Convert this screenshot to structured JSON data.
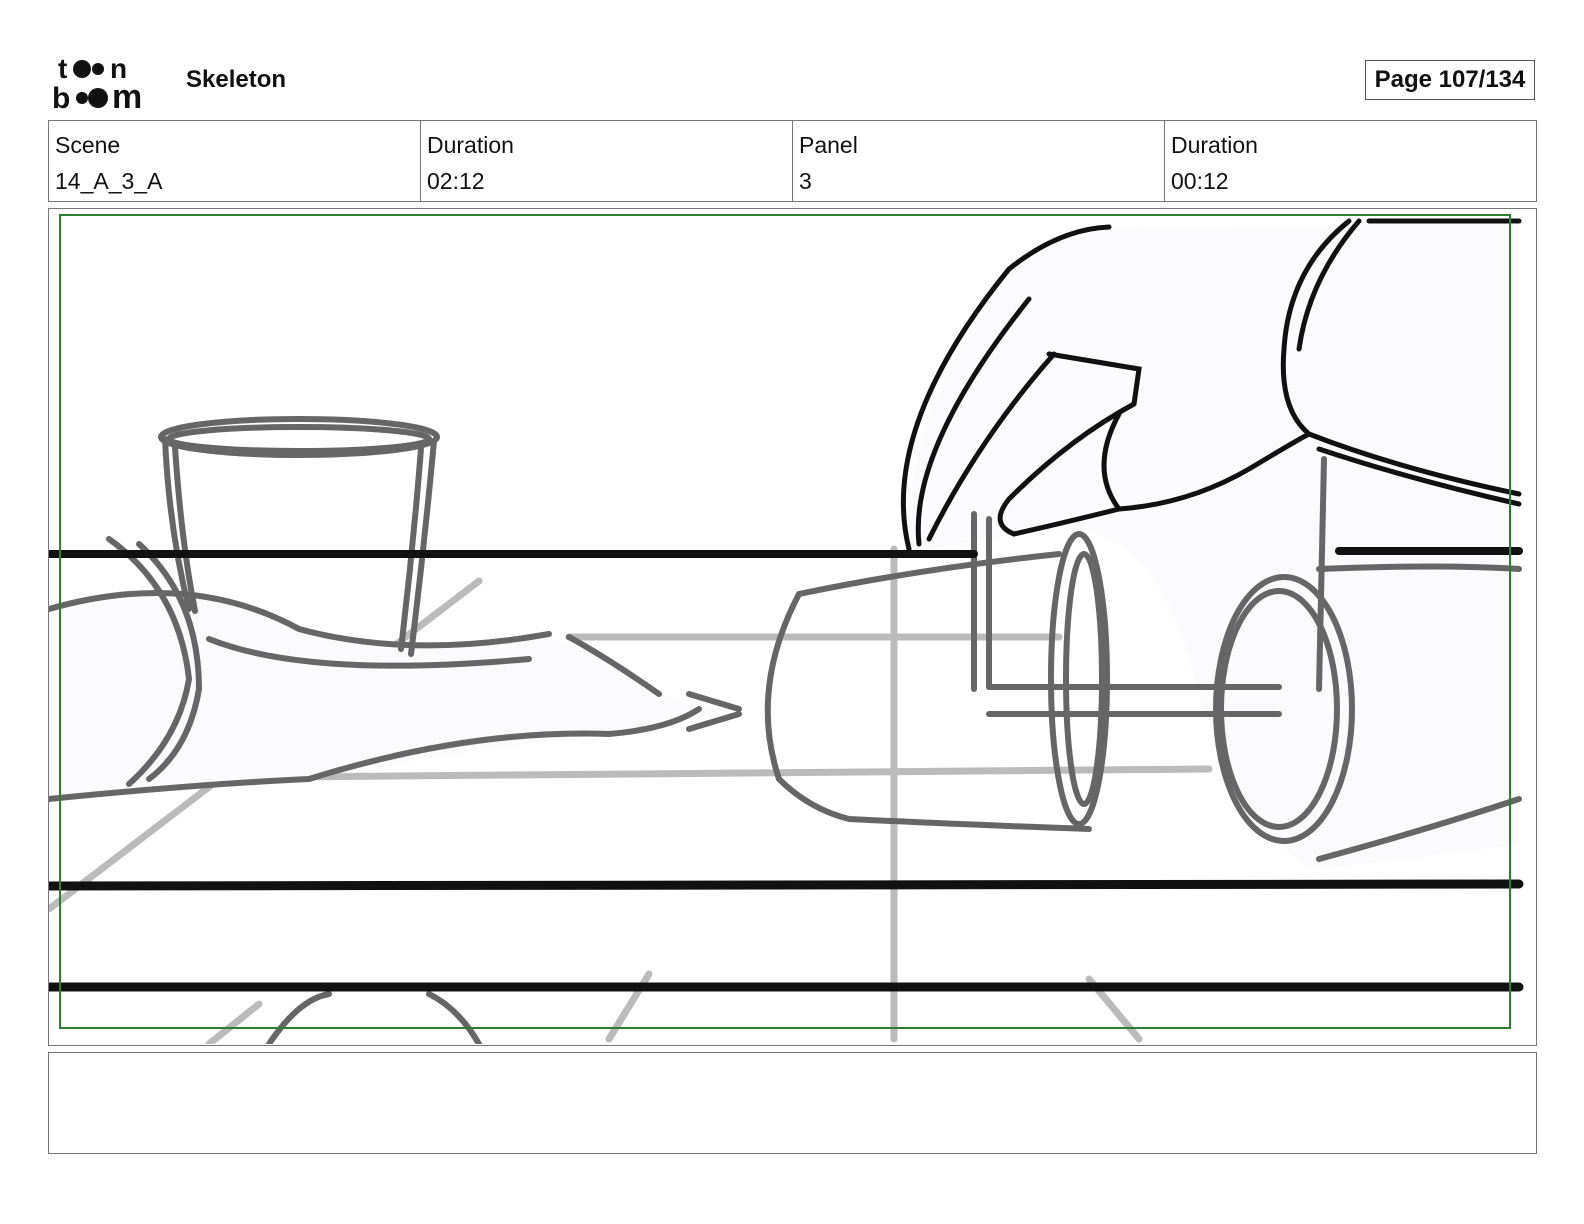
{
  "header": {
    "logo_text": "toon boom",
    "project_title": "Skeleton",
    "page_label": "Page 107/134"
  },
  "info": {
    "scene_label": "Scene",
    "scene_value": "14_A_3_A",
    "scene_duration_label": "Duration",
    "scene_duration_value": "02:12",
    "panel_label": "Panel",
    "panel_value": "3",
    "panel_duration_label": "Duration",
    "panel_duration_value": "00:12"
  },
  "colors": {
    "safe_frame": "#2e7d32",
    "sketch_dark": "#111111",
    "sketch_mid": "#666666",
    "sketch_light": "#bbbbbb"
  },
  "notes": {
    "text": ""
  }
}
